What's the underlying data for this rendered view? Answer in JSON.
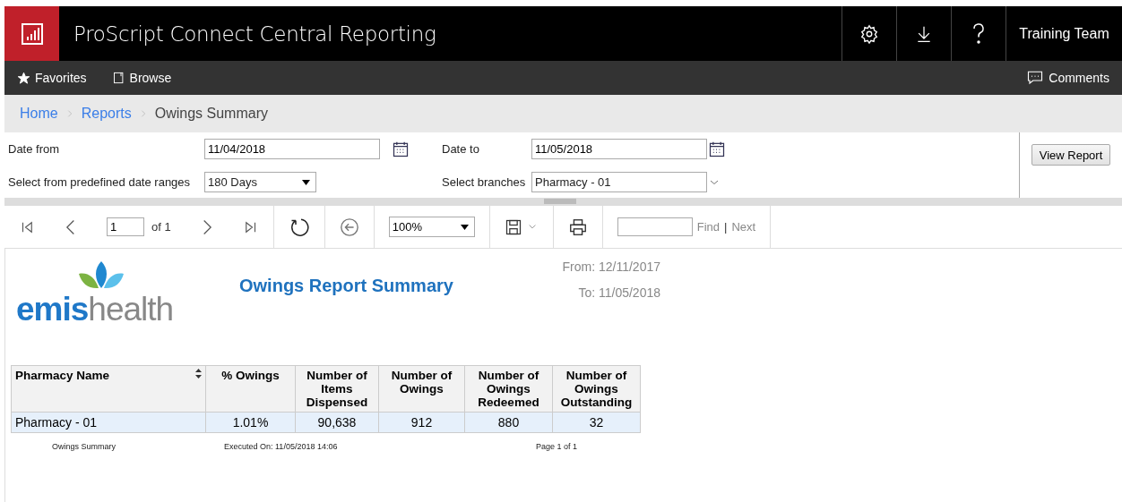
{
  "app": {
    "title": "ProScript Connect Central Reporting",
    "user": "Training Team"
  },
  "nav": {
    "items": [
      {
        "label": "Favorites",
        "kind": "star"
      },
      {
        "label": "Browse",
        "kind": "book"
      }
    ],
    "comments": "Comments"
  },
  "breadcrumb": [
    {
      "label": "Home",
      "current": false
    },
    {
      "label": "Reports",
      "current": false
    },
    {
      "label": "Owings Summary",
      "current": true
    }
  ],
  "parameters": {
    "date_from": {
      "label": "Date from",
      "value": "11/04/2018"
    },
    "date_to": {
      "label": "Date to",
      "value": "11/05/2018"
    },
    "date_range": {
      "label": "Select from predefined date ranges",
      "value": "180 Days"
    },
    "branches": {
      "label": "Select branches",
      "value": "Pharmacy - 01"
    },
    "view_button": "View Report"
  },
  "toolbar": {
    "page": "1",
    "page_count": "of 1",
    "zoom": "100%",
    "find_label": "Find",
    "find_separator": "|",
    "next_label": "Next"
  },
  "report": {
    "logo": {
      "strong": "emis",
      "light": "health"
    },
    "title": "Owings Report Summary",
    "from": "From: 12/11/2017",
    "to": "To: 11/05/2018",
    "table": {
      "columns": [
        "Pharmacy Name",
        "% Owings",
        "Number of Items Dispensed",
        "Number of Owings",
        "Number of Owings Redeemed",
        "Number of Owings Outstanding"
      ],
      "rows": [
        {
          "cells": [
            "Pharmacy - 01",
            "1.01%",
            "90,638",
            "912",
            "880",
            "32"
          ]
        }
      ]
    },
    "footer": {
      "name": "Owings Summary",
      "executed": "Executed On: 11/05/2018 14:06",
      "page": "Page 1 of 1"
    }
  }
}
